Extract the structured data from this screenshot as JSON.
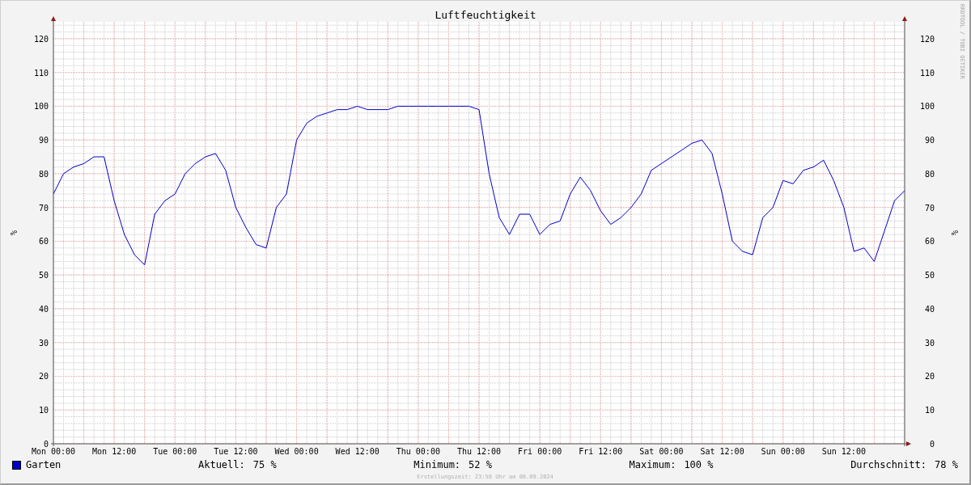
{
  "chart_data": {
    "type": "line",
    "title": "Luftfeuchtigkeit",
    "ylabel": "%",
    "categories": [
      "Mon 00:00",
      null,
      null,
      null,
      null,
      null,
      "Mon 12:00",
      null,
      null,
      null,
      null,
      null,
      "Tue 00:00",
      null,
      null,
      null,
      null,
      null,
      "Tue 12:00",
      null,
      null,
      null,
      null,
      null,
      "Wed 00:00",
      null,
      null,
      null,
      null,
      null,
      "Wed 12:00",
      null,
      null,
      null,
      null,
      null,
      "Thu 00:00",
      null,
      null,
      null,
      null,
      null,
      "Thu 12:00",
      null,
      null,
      null,
      null,
      null,
      "Fri 00:00",
      null,
      null,
      null,
      null,
      null,
      "Fri 12:00",
      null,
      null,
      null,
      null,
      null,
      "Sat 00:00",
      null,
      null,
      null,
      null,
      null,
      "Sat 12:00",
      null,
      null,
      null,
      null,
      null,
      "Sun 00:00",
      null,
      null,
      null,
      null,
      null,
      "Sun 12:00",
      null,
      null,
      null,
      null,
      null,
      null
    ],
    "series": [
      {
        "name": "Garten",
        "color": "#0000cc",
        "values": [
          74,
          80,
          82,
          83,
          85,
          85,
          72,
          62,
          56,
          53,
          68,
          72,
          74,
          80,
          83,
          85,
          86,
          81,
          70,
          64,
          59,
          58,
          70,
          74,
          90,
          95,
          97,
          98,
          99,
          99,
          100,
          99,
          99,
          99,
          100,
          100,
          100,
          100,
          100,
          100,
          100,
          100,
          99,
          80,
          67,
          62,
          68,
          68,
          62,
          65,
          66,
          74,
          79,
          75,
          69,
          65,
          67,
          70,
          74,
          81,
          83,
          85,
          87,
          89,
          90,
          86,
          74,
          60,
          57,
          56,
          67,
          70,
          78,
          77,
          81,
          82,
          84,
          78,
          70,
          57,
          58,
          54,
          63,
          72,
          75
        ]
      }
    ],
    "grid": true,
    "ylim": [
      0,
      125
    ],
    "yticks": [
      0,
      10,
      20,
      30,
      40,
      50,
      60,
      70,
      80,
      90,
      100,
      110,
      120
    ]
  },
  "right_axis": {
    "unit": "%",
    "labels": [
      "120",
      "110",
      "100",
      "90",
      "80",
      "70",
      "60",
      "50",
      "40",
      "30",
      "20",
      "10",
      "0"
    ]
  },
  "credit": "RRDTOOL / TOBI OETIKER",
  "legend": {
    "stats": [
      {
        "label": "Aktuell:",
        "value": "75 %"
      },
      {
        "label": "Minimum:",
        "value": "52 %"
      },
      {
        "label": "Maximum:",
        "value": "100 %"
      },
      {
        "label": "Durchschnitt:",
        "value": "78 %"
      }
    ]
  },
  "footer": "Erstellungszeit: 23:58 Uhr am 08.09.2024"
}
